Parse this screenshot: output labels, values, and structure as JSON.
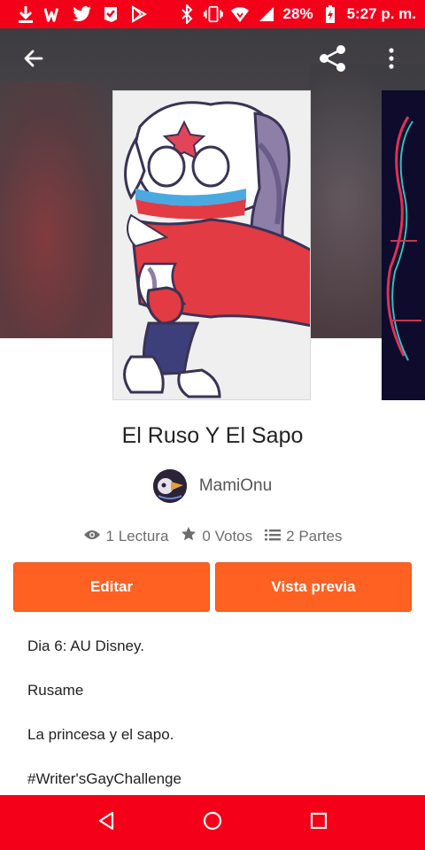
{
  "status_bar": {
    "battery": "28%",
    "time": "5:27 p. m.",
    "left_icons": [
      "download-icon",
      "wattpad-icon",
      "twitter-icon",
      "paste-icon",
      "play-store-icon"
    ],
    "right_icons": [
      "bluetooth-icon",
      "vibrate-icon",
      "wifi-icon",
      "signal-icon",
      "battery-charging-icon"
    ]
  },
  "app_bar": {
    "back_icon": "arrow-left-icon",
    "share_icon": "share-icon",
    "more_icon": "more-vertical-icon"
  },
  "story": {
    "title": "El Ruso Y El Sapo",
    "author": "MamiOnu",
    "reads": "1 Lectura",
    "votes": "0 Votos",
    "parts": "2 Partes"
  },
  "actions": {
    "edit_label": "Editar",
    "preview_label": "Vista previa"
  },
  "description": [
    "Dia 6: AU Disney.",
    "Rusame",
    "La princesa y el sapo.",
    "#Writer'sGayChallenge"
  ],
  "colors": {
    "accent": "#ff6122",
    "system_bar": "#f40019"
  }
}
